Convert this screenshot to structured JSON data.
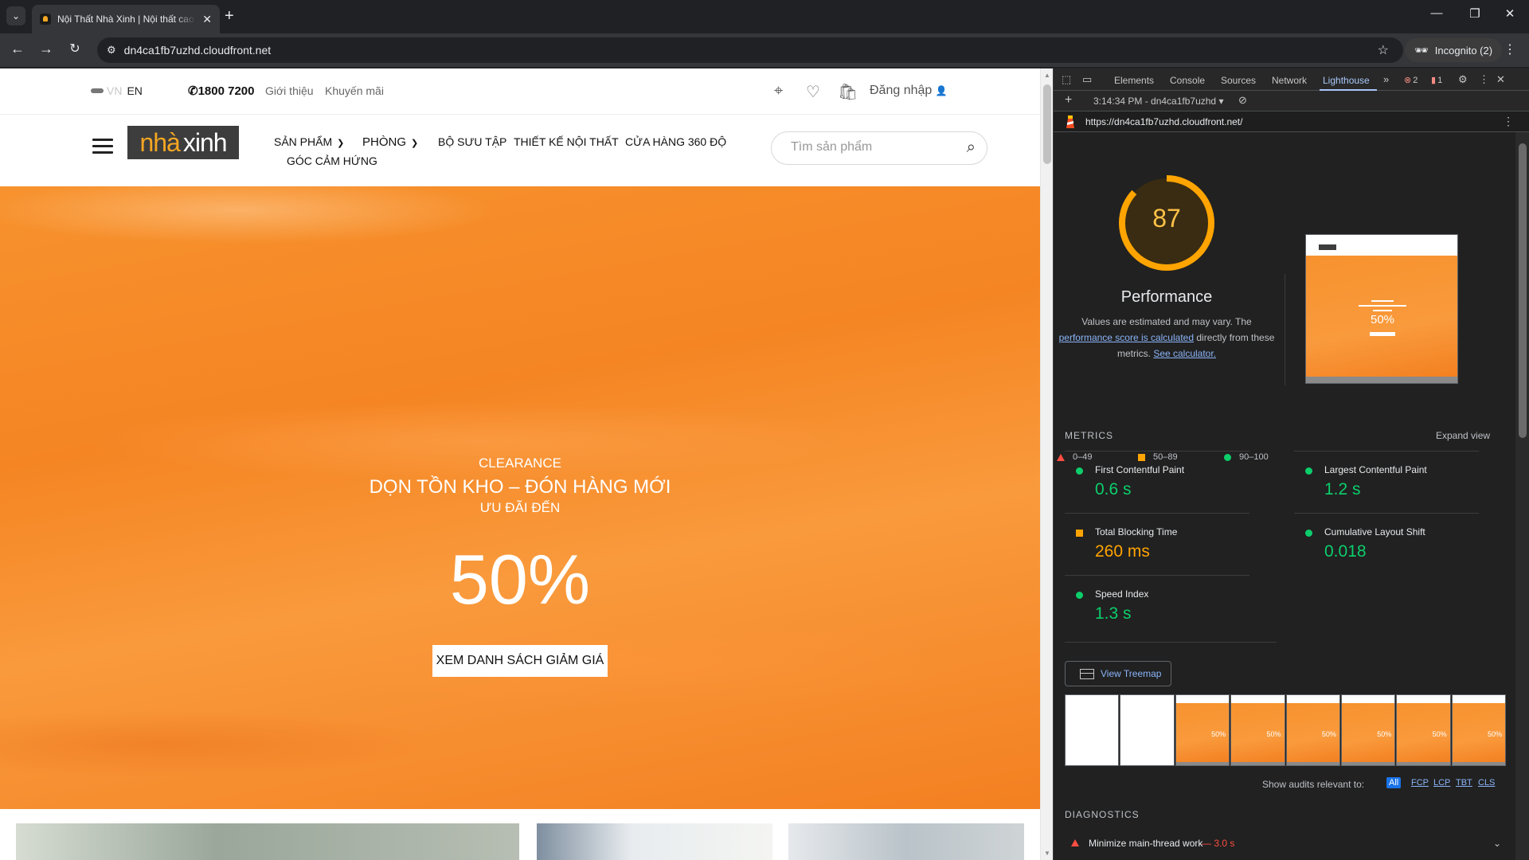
{
  "browser": {
    "tab_title": "Nội Thất Nhà Xinh | Nội thất cao cấp",
    "url": "dn4ca1fb7uzhd.cloudfront.net",
    "incognito_label": "Incognito (2)"
  },
  "site": {
    "lang_vn": "VN",
    "lang_en": "EN",
    "hotline": "1800 7200",
    "link_about": "Giới thiệu",
    "link_promo": "Khuyến mãi",
    "login": "Đăng nhập",
    "logo_nha": "nhà",
    "logo_xinh": "xinh",
    "nav": {
      "products": "SẢN PHẨM",
      "rooms": "PHÒNG",
      "collections": "BỘ SƯU TẬP",
      "design": "THIẾT KẾ NỘI THẤT",
      "store360": "CỬA HÀNG 360 ĐỘ",
      "inspiration": "GÓC CẢM HỨNG"
    },
    "search_placeholder": "Tìm sản phẩm",
    "hero": {
      "eyebrow": "CLEARANCE",
      "headline": "DỌN TỒN KHO – ĐÓN HÀNG MỚI",
      "sub": "ƯU ĐÃI ĐẾN",
      "percent": "50%",
      "cta": "XEM DANH SÁCH GIẢM GIÁ"
    }
  },
  "devtools": {
    "tabs": [
      "Elements",
      "Console",
      "Sources",
      "Network",
      "Lighthouse"
    ],
    "error_count": "2",
    "issue_count": "1",
    "report_label": "3:14:34 PM - dn4ca1fb7uzhd",
    "lighthouse_url": "https://dn4ca1fb7uzhd.cloudfront.net/",
    "score": "87",
    "score_fraction": 0.87,
    "category": "Performance",
    "desc_1": "Values are estimated and may vary. The",
    "desc_link_1": "performance score is calculated",
    "desc_2": "directly from these metrics.",
    "desc_link_2": "See calculator.",
    "legend": {
      "fail": "0–49",
      "average": "50–89",
      "pass": "90–100"
    },
    "metrics_title": "METRICS",
    "expand_view": "Expand view",
    "metrics": {
      "fcp_name": "First Contentful Paint",
      "fcp_value": "0.6 s",
      "lcp_name": "Largest Contentful Paint",
      "lcp_value": "1.2 s",
      "tbt_name": "Total Blocking Time",
      "tbt_value": "260 ms",
      "cls_name": "Cumulative Layout Shift",
      "cls_value": "0.018",
      "si_name": "Speed Index",
      "si_value": "1.3 s"
    },
    "view_treemap": "View Treemap",
    "filmstrip_percent": "50%",
    "show_audits": "Show audits relevant to:",
    "audit_filters": [
      "All",
      "FCP",
      "LCP",
      "TBT",
      "CLS"
    ],
    "diagnostics_title": "DIAGNOSTICS",
    "diag_item": "Minimize main-thread work",
    "diag_value": "— 3.0 s",
    "thumb_percent": "50%"
  },
  "colors": {
    "accent_orange": "#f58523",
    "lh_average": "#ffa400",
    "lh_pass": "#0cce6b",
    "lh_fail": "#ff4e42",
    "devtools_link": "#8ab4f8"
  }
}
